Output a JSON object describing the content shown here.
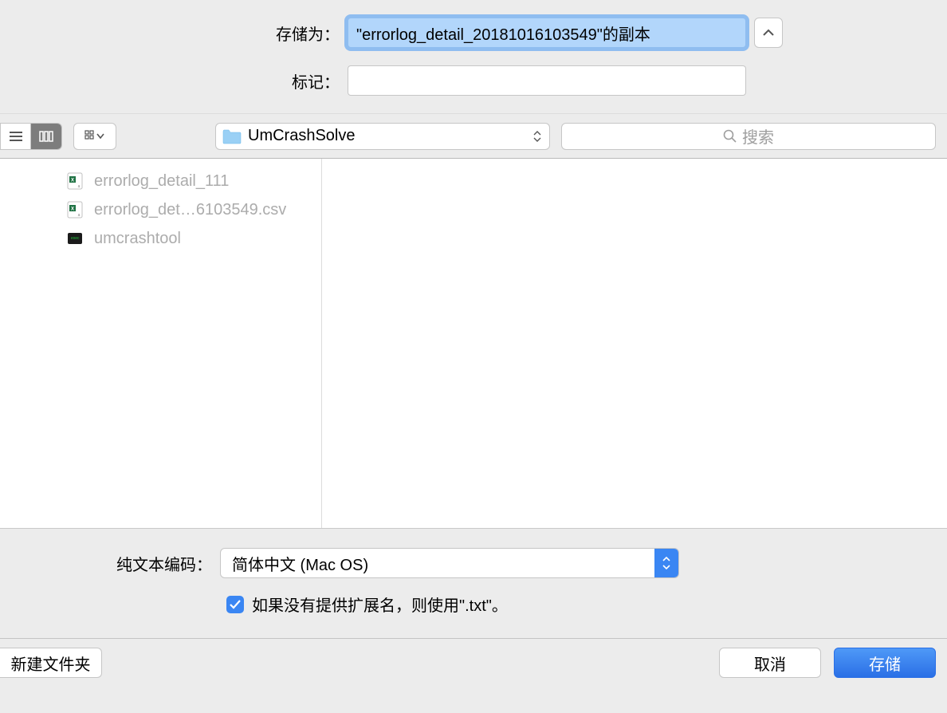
{
  "labels": {
    "save_as": "存储为：",
    "tags": "标记："
  },
  "save_as_value": "\"errorlog_detail_20181016103549\"的副本",
  "tags_value": "",
  "toolbar": {
    "current_folder": "UmCrashSolve",
    "search_placeholder": "搜索"
  },
  "files": [
    {
      "name": "errorlog_detail_111",
      "icon": "excel-doc"
    },
    {
      "name": "errorlog_det…6103549.csv",
      "icon": "excel-csv"
    },
    {
      "name": "umcrashtool",
      "icon": "exec"
    }
  ],
  "options": {
    "text_encoding_label": "纯文本编码：",
    "text_encoding_value": "简体中文 (Mac OS)",
    "use_txt_label": "如果没有提供扩展名，则使用\".txt\"。"
  },
  "footer": {
    "new_folder": "新建文件夹",
    "cancel": "取消",
    "save": "存储"
  }
}
